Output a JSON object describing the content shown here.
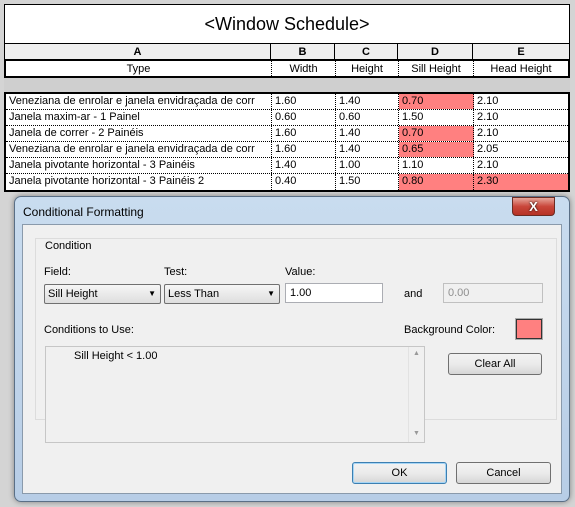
{
  "schedule": {
    "title": "<Window Schedule>",
    "column_letters": [
      "A",
      "B",
      "C",
      "D",
      "E"
    ],
    "column_names": [
      "Type",
      "Width",
      "Height",
      "Sill Height",
      "Head Height"
    ],
    "rows": [
      {
        "type": "Veneziana de enrolar e janela envidraçada de corr",
        "width": "1.60",
        "height": "1.40",
        "sill": "0.70",
        "head": "2.10"
      },
      {
        "type": "Janela maxim-ar - 1 Painel",
        "width": "0.60",
        "height": "0.60",
        "sill": "1.50",
        "head": "2.10"
      },
      {
        "type": "Janela de correr - 2 Painéis",
        "width": "1.60",
        "height": "1.40",
        "sill": "0.70",
        "head": "2.10"
      },
      {
        "type": "Veneziana de enrolar e janela envidraçada de corr",
        "width": "1.60",
        "height": "1.40",
        "sill": "0.65",
        "head": "2.05"
      },
      {
        "type": "Janela pivotante horizontal - 3 Painéis",
        "width": "1.40",
        "height": "1.00",
        "sill": "1.10",
        "head": "2.10"
      },
      {
        "type": "Janela pivotante horizontal - 3 Painéis 2",
        "width": "0.40",
        "height": "1.50",
        "sill": "0.80",
        "head": "2.30"
      }
    ],
    "highlight_color": "#ff8080"
  },
  "dialog": {
    "title": "Conditional Formatting",
    "close_label": "X",
    "condition_group": "Condition",
    "field_label": "Field:",
    "field_value": "Sill Height",
    "test_label": "Test:",
    "test_value": "Less Than",
    "value_label": "Value:",
    "value": "1.00",
    "and_label": "and",
    "and_value": "0.00",
    "conditions_label": "Conditions to Use:",
    "conditions": [
      "Sill Height < 1.00"
    ],
    "bg_color_label": "Background Color:",
    "bg_color": "#ff8080",
    "clear_all": "Clear All",
    "ok": "OK",
    "cancel": "Cancel"
  }
}
